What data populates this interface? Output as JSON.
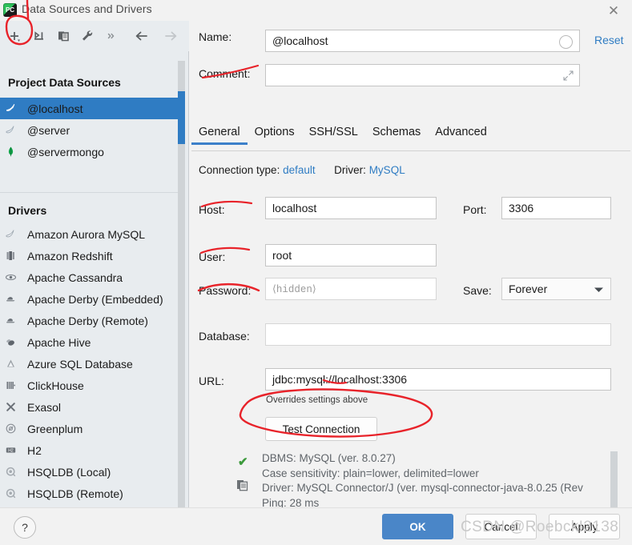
{
  "window": {
    "title": "Data Sources and Drivers",
    "app_icon": "pycharm-logo-icon",
    "close_label": "✕"
  },
  "sidebar": {
    "toolbar": [
      {
        "name": "add-data-source-button",
        "icon": "plus-icon",
        "label": "+",
        "disabled": false
      },
      {
        "name": "remove-data-source-button",
        "icon": "minus-icon",
        "label": "−",
        "disabled": false
      },
      {
        "name": "duplicate-data-source-button",
        "icon": "copy-icon",
        "label": "copy",
        "disabled": false
      },
      {
        "name": "driver-properties-button",
        "icon": "wrench-icon",
        "label": "wrench",
        "disabled": false
      },
      {
        "name": "more-options-button",
        "icon": "chevrons-right-icon",
        "label": "»",
        "disabled": false
      },
      {
        "name": "navigate-back-button",
        "icon": "arrow-left-icon",
        "label": "←",
        "disabled": false
      },
      {
        "name": "navigate-forward-button",
        "icon": "arrow-right-icon",
        "label": "→",
        "disabled": true
      }
    ],
    "project_header": "Project Data Sources",
    "data_sources": [
      {
        "label": "@localhost",
        "icon": "mysql-dolphin-icon",
        "selected": true
      },
      {
        "label": "@server",
        "icon": "mysql-dolphin-gray-icon",
        "selected": false
      },
      {
        "label": "@servermongo",
        "icon": "mongodb-leaf-icon",
        "selected": false
      }
    ],
    "drivers_header": "Drivers",
    "drivers": [
      {
        "label": "Amazon Aurora MySQL",
        "icon": "aurora-dolphin-icon"
      },
      {
        "label": "Amazon Redshift",
        "icon": "redshift-icon"
      },
      {
        "label": "Apache Cassandra",
        "icon": "cassandra-eye-icon"
      },
      {
        "label": "Apache Derby (Embedded)",
        "icon": "derby-hat-icon"
      },
      {
        "label": "Apache Derby (Remote)",
        "icon": "derby-hat-icon"
      },
      {
        "label": "Apache Hive",
        "icon": "hive-bee-icon"
      },
      {
        "label": "Azure SQL Database",
        "icon": "azure-triangle-icon"
      },
      {
        "label": "ClickHouse",
        "icon": "clickhouse-bars-icon"
      },
      {
        "label": "Exasol",
        "icon": "exasol-x-icon"
      },
      {
        "label": "Greenplum",
        "icon": "greenplum-circle-icon"
      },
      {
        "label": "H2",
        "icon": "h2-badge-icon"
      },
      {
        "label": "HSQLDB (Local)",
        "icon": "hsqldb-icon"
      },
      {
        "label": "HSQLDB (Remote)",
        "icon": "hsqldb-icon"
      }
    ]
  },
  "form": {
    "name_label": "Name:",
    "name_value": "@localhost",
    "name_indicator": "progress-circle-icon",
    "comment_label": "Comment:",
    "comment_value": "",
    "comment_expand": "expand-icon",
    "reset_label": "Reset",
    "tabs": [
      {
        "label": "General",
        "active": true
      },
      {
        "label": "Options",
        "active": false
      },
      {
        "label": "SSH/SSL",
        "active": false
      },
      {
        "label": "Schemas",
        "active": false
      },
      {
        "label": "Advanced",
        "active": false
      }
    ],
    "connection_type_label": "Connection type:",
    "connection_type_value": "default",
    "driver_label": "Driver:",
    "driver_value": "MySQL",
    "host_label": "Host:",
    "host_value": "localhost",
    "port_label": "Port:",
    "port_value": "3306",
    "user_label": "User:",
    "user_value": "root",
    "password_label": "Password:",
    "password_placeholder": "⟨hidden⟩",
    "password_value": "",
    "save_label": "Save:",
    "save_value": "Forever",
    "database_label": "Database:",
    "database_value": "",
    "url_label": "URL:",
    "url_value": "jdbc:mysql://localhost:3306",
    "url_hint": "Overrides settings above",
    "test_connection_label": "Test Connection"
  },
  "test_result": {
    "status_icon": "green-check-icon",
    "copy_icon": "copy-icon",
    "line1": "DBMS: MySQL (ver. 8.0.27)",
    "line2": "Case sensitivity: plain=lower, delimited=lower",
    "line3": "Driver: MySQL Connector/J (ver. mysql-connector-java-8.0.25 (Rev",
    "line4": "Ping: 28 ms"
  },
  "footer": {
    "help_label": "?",
    "ok_label": "OK",
    "cancel_label": "Cancel",
    "apply_label": "Apply"
  },
  "watermark": {
    "text": "CSDN @RoebckI2138"
  },
  "colors": {
    "selection_blue": "#2f7cc3",
    "link_blue": "#2f7cc3",
    "primary_button": "#4a86c8",
    "annotation_red": "#e8232a",
    "success_green": "#3c9a3c",
    "sidebar_bg": "#e8ecef",
    "panel_bg": "#f2f2f2"
  }
}
